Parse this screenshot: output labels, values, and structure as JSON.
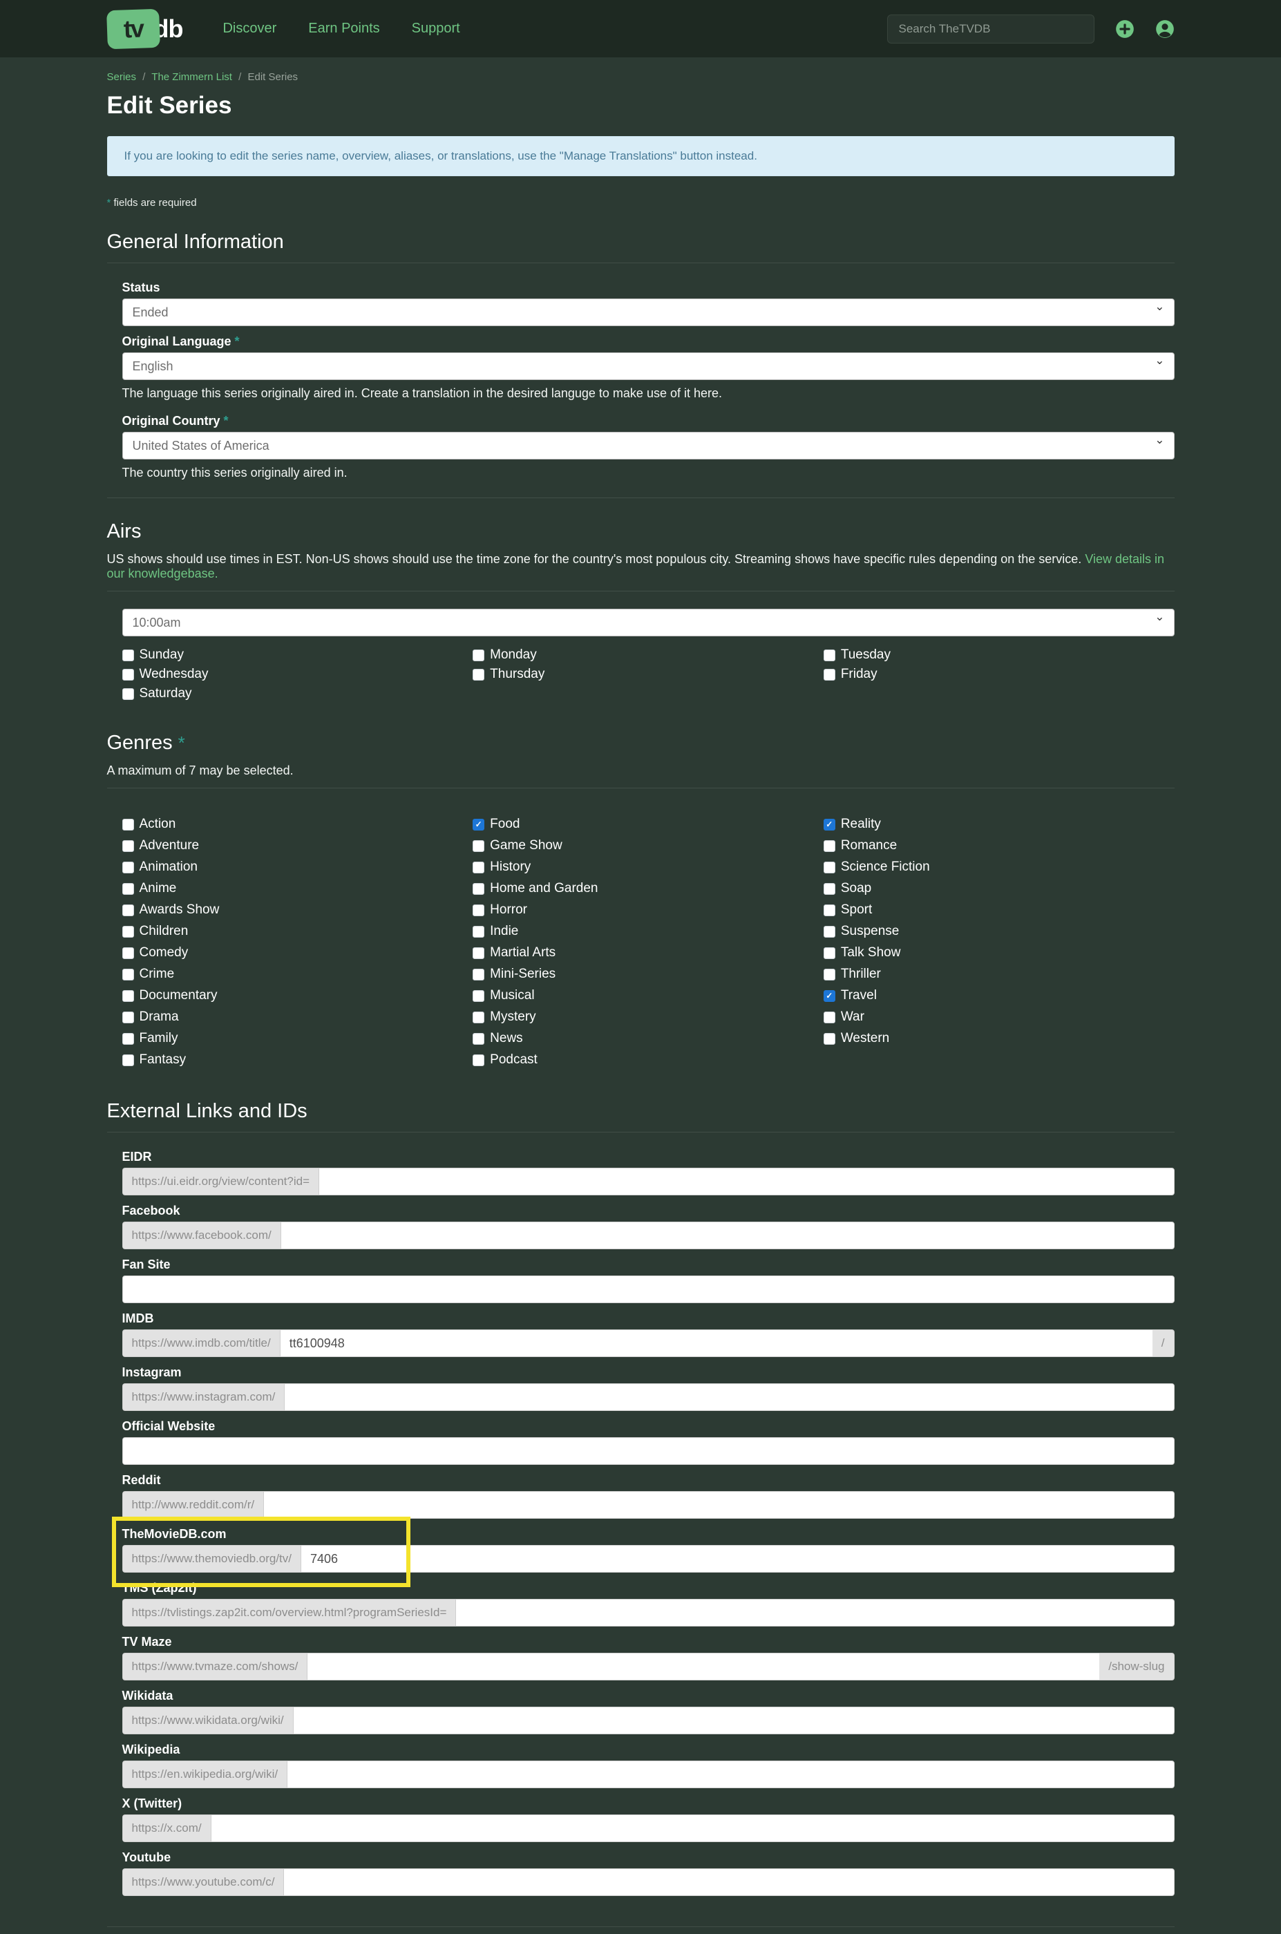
{
  "colors": {
    "header_bg": "#1e2922",
    "page_bg": "#2c3a33",
    "accent_green": "#6fc583",
    "checkbox_checked_blue": "#1d76d6",
    "highlight_yellow": "#f4e32c",
    "alert_bg": "#d9edf7",
    "alert_text": "#4a7b97",
    "required_teal": "#2f9e8f"
  },
  "header": {
    "logo": {
      "tv": "tv",
      "db": "db"
    },
    "nav": [
      {
        "label": "Discover"
      },
      {
        "label": "Earn Points"
      },
      {
        "label": "Support"
      }
    ],
    "search": {
      "placeholder": "Search TheTVDB"
    },
    "icons": {
      "add": "plus-circle",
      "account": "user-circle"
    }
  },
  "breadcrumb": {
    "separator": "/",
    "items": [
      {
        "label": "Series"
      },
      {
        "label": "The Zimmern List"
      },
      {
        "label": "Edit Series"
      }
    ]
  },
  "page": {
    "title": "Edit Series",
    "alert": "If you are looking to edit the series name, overview, aliases, or translations, use the \"Manage Translations\" button instead.",
    "required_marker": "*",
    "required_note": "fields are required"
  },
  "general": {
    "heading": "General Information",
    "status": {
      "label": "Status",
      "value": "Ended"
    },
    "original_language": {
      "label": "Original Language",
      "value": "English",
      "helper": "The language this series originally aired in. Create a translation in the desired languge to make use of it here."
    },
    "original_country": {
      "label": "Original Country",
      "value": "United States of America",
      "helper": "The country this series originally aired in."
    }
  },
  "airs": {
    "heading": "Airs",
    "description": "US shows should use times in EST. Non-US shows should use the time zone for the country's most populous city. Streaming shows have specific rules depending on the service.",
    "link_text": "View details in our knowledgebase.",
    "time_value": "10:00am",
    "day_columns": [
      [
        {
          "label": "Sunday",
          "checked": false
        },
        {
          "label": "Wednesday",
          "checked": false
        },
        {
          "label": "Saturday",
          "checked": false
        }
      ],
      [
        {
          "label": "Monday",
          "checked": false
        },
        {
          "label": "Thursday",
          "checked": false
        }
      ],
      [
        {
          "label": "Tuesday",
          "checked": false
        },
        {
          "label": "Friday",
          "checked": false
        }
      ]
    ]
  },
  "genres": {
    "heading": "Genres",
    "description": "A maximum of 7 may be selected.",
    "columns": [
      [
        {
          "label": "Action",
          "checked": false
        },
        {
          "label": "Adventure",
          "checked": false
        },
        {
          "label": "Animation",
          "checked": false
        },
        {
          "label": "Anime",
          "checked": false
        },
        {
          "label": "Awards Show",
          "checked": false
        },
        {
          "label": "Children",
          "checked": false
        },
        {
          "label": "Comedy",
          "checked": false
        },
        {
          "label": "Crime",
          "checked": false
        },
        {
          "label": "Documentary",
          "checked": false
        },
        {
          "label": "Drama",
          "checked": false
        },
        {
          "label": "Family",
          "checked": false
        },
        {
          "label": "Fantasy",
          "checked": false
        }
      ],
      [
        {
          "label": "Food",
          "checked": true
        },
        {
          "label": "Game Show",
          "checked": false
        },
        {
          "label": "History",
          "checked": false
        },
        {
          "label": "Home and Garden",
          "checked": false
        },
        {
          "label": "Horror",
          "checked": false
        },
        {
          "label": "Indie",
          "checked": false
        },
        {
          "label": "Martial Arts",
          "checked": false
        },
        {
          "label": "Mini-Series",
          "checked": false
        },
        {
          "label": "Musical",
          "checked": false
        },
        {
          "label": "Mystery",
          "checked": false
        },
        {
          "label": "News",
          "checked": false
        },
        {
          "label": "Podcast",
          "checked": false
        }
      ],
      [
        {
          "label": "Reality",
          "checked": true
        },
        {
          "label": "Romance",
          "checked": false
        },
        {
          "label": "Science Fiction",
          "checked": false
        },
        {
          "label": "Soap",
          "checked": false
        },
        {
          "label": "Sport",
          "checked": false
        },
        {
          "label": "Suspense",
          "checked": false
        },
        {
          "label": "Talk Show",
          "checked": false
        },
        {
          "label": "Thriller",
          "checked": false
        },
        {
          "label": "Travel",
          "checked": true
        },
        {
          "label": "War",
          "checked": false
        },
        {
          "label": "Western",
          "checked": false
        }
      ]
    ]
  },
  "external": {
    "heading": "External Links and IDs",
    "fields": [
      {
        "label": "EIDR",
        "prefix": "https://ui.eidr.org/view/content?id=",
        "value": "",
        "suffix": "",
        "highlighted": false
      },
      {
        "label": "Facebook",
        "prefix": "https://www.facebook.com/",
        "value": "",
        "suffix": "",
        "highlighted": false
      },
      {
        "label": "Fan Site",
        "prefix": "",
        "value": "",
        "suffix": "",
        "highlighted": false
      },
      {
        "label": "IMDB",
        "prefix": "https://www.imdb.com/title/",
        "value": "tt6100948",
        "suffix": "/",
        "highlighted": false
      },
      {
        "label": "Instagram",
        "prefix": "https://www.instagram.com/",
        "value": "",
        "suffix": "",
        "highlighted": false
      },
      {
        "label": "Official Website",
        "prefix": "",
        "value": "",
        "suffix": "",
        "highlighted": false
      },
      {
        "label": "Reddit",
        "prefix": "http://www.reddit.com/r/",
        "value": "",
        "suffix": "",
        "highlighted": false
      },
      {
        "label": "TheMovieDB.com",
        "prefix": "https://www.themoviedb.org/tv/",
        "value": "7406",
        "suffix": "",
        "highlighted": true
      },
      {
        "label": "TMS (Zap2It)",
        "prefix": "https://tvlistings.zap2it.com/overview.html?programSeriesId=",
        "value": "",
        "suffix": "",
        "highlighted": false
      },
      {
        "label": "TV Maze",
        "prefix": "https://www.tvmaze.com/shows/",
        "value": "",
        "suffix": "/show-slug",
        "highlighted": false
      },
      {
        "label": "Wikidata",
        "prefix": "https://www.wikidata.org/wiki/",
        "value": "",
        "suffix": "",
        "highlighted": false
      },
      {
        "label": "Wikipedia",
        "prefix": "https://en.wikipedia.org/wiki/",
        "value": "",
        "suffix": "",
        "highlighted": false
      },
      {
        "label": "X (Twitter)",
        "prefix": "https://x.com/",
        "value": "",
        "suffix": "",
        "highlighted": false
      },
      {
        "label": "Youtube",
        "prefix": "https://www.youtube.com/c/",
        "value": "",
        "suffix": "",
        "highlighted": false
      }
    ]
  }
}
